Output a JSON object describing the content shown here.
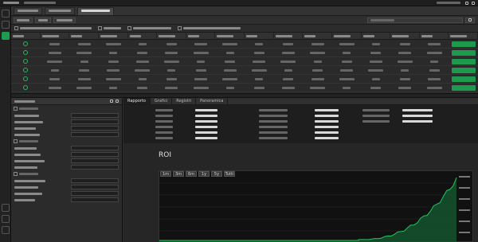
{
  "report": {
    "tabs": [
      "Rapporto",
      "Grafici",
      "Registri",
      "Panoramica"
    ],
    "chart_title": "ROI",
    "range_buttons": [
      "1m",
      "3m",
      "6m",
      "1y",
      "5y",
      "Tutti"
    ]
  },
  "colors": {
    "accent_green": "#1d9a4e",
    "chart_green": "#22c55e",
    "background": "#2b2b2b"
  },
  "icons": [
    "settings-icon",
    "chart-icon",
    "person-icon",
    "bell-icon",
    "close-icon",
    "minimize-icon"
  ],
  "table": {
    "row_count": 6,
    "column_count": 16
  }
}
